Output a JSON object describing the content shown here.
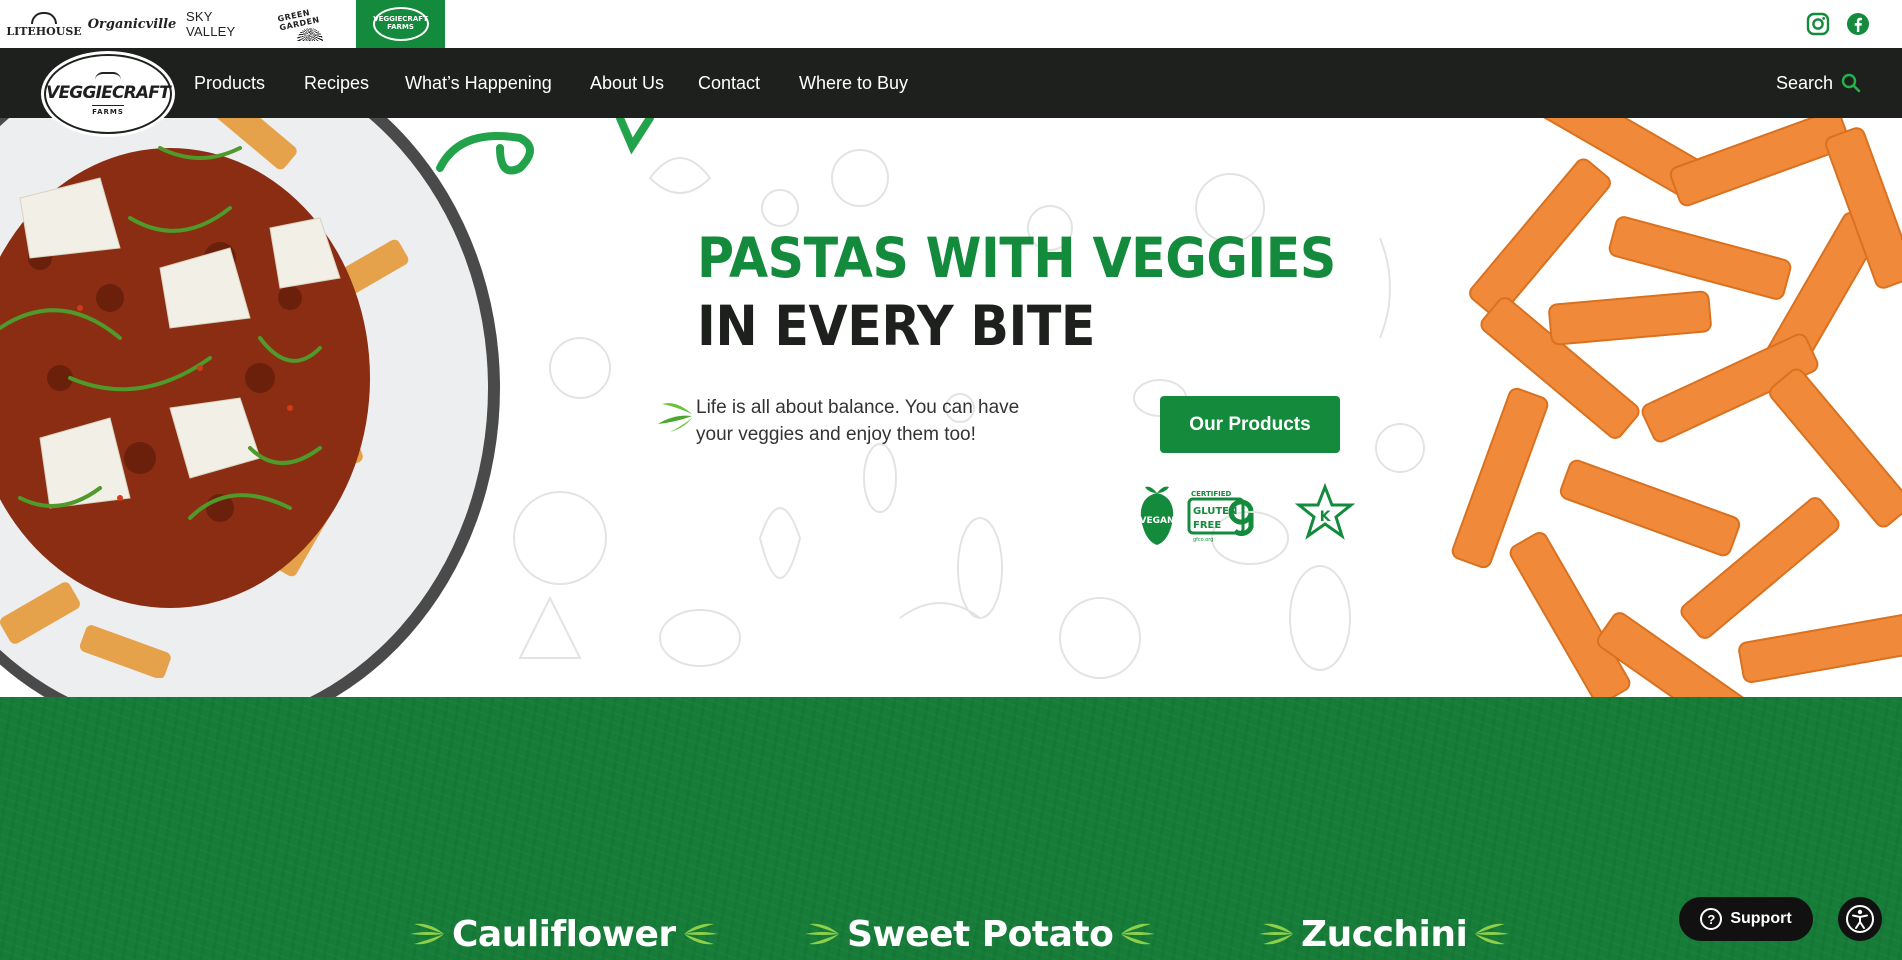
{
  "brands": {
    "litehouse": "LITEHOUSE",
    "organicville": "Organicville",
    "sky_valley": "SKY VALLEY",
    "green_garden": "GREEN GARDEN",
    "veggiecraft": "VEGGIECRAFT FARMS"
  },
  "social": [
    "instagram-icon",
    "facebook-icon"
  ],
  "nav": {
    "logo_word": "VEGGIECRAFT",
    "logo_sub": "FARMS",
    "links": [
      "Products",
      "Recipes",
      "What’s Happening",
      "About Us",
      "Contact",
      "Where to Buy"
    ],
    "search_label": "Search"
  },
  "hero": {
    "headline_green": "PASTAS WITH VEGGIES",
    "headline_black": "IN EVERY BITE",
    "tagline": "Life is all about balance. You can have your veggies and enjoy them too!",
    "cta": "Our Products",
    "badges": {
      "vegan": "VEGAN",
      "gf_top": "CERTIFIED",
      "gf_mid1": "GLUTEN",
      "gf_mid2": "FREE",
      "gf_bottom": "gfco.org",
      "kosher": "K"
    }
  },
  "veggies": [
    "Cauliflower",
    "Sweet Potato",
    "Zucchini"
  ],
  "support_label": "Support",
  "colors": {
    "brand_green": "#148a3c",
    "dark": "#1e201e",
    "section_green": "#167c38"
  }
}
